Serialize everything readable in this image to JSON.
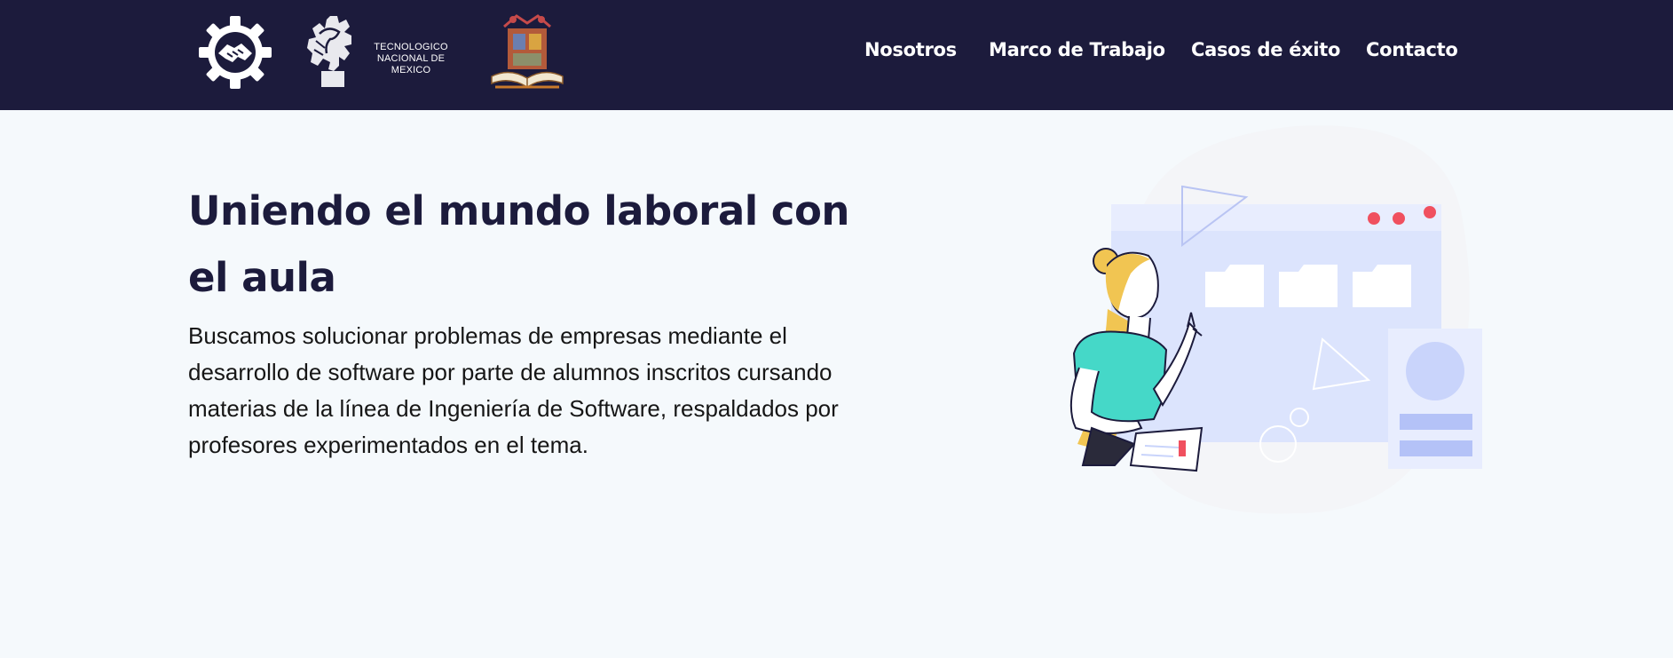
{
  "header": {
    "logos": [
      {
        "name": "handshake-gear-logo"
      },
      {
        "name": "tecnm-logo",
        "text_line1": "TECNOLOGICO",
        "text_line2": "NACIONAL DE MEXICO"
      },
      {
        "name": "institute-crest-logo"
      }
    ],
    "nav": [
      "Nosotros",
      "Marco de Trabajo",
      "Casos de éxito",
      "Contacto"
    ]
  },
  "hero": {
    "title": "Uniendo el mundo laboral con el aula",
    "description": "Buscamos solucionar problemas de empresas mediante el desarrollo de software por parte de alumnos inscritos cursando materias de la línea de Ingeniería de Software, respaldados por profesores experimentados en el tema."
  },
  "colors": {
    "header_bg": "#1c1b3c",
    "page_bg": "#f5f9fc",
    "title": "#1c1b3c",
    "accent_teal": "#45d8c8",
    "accent_red": "#f0505f",
    "window_blue": "#dce4fd"
  }
}
